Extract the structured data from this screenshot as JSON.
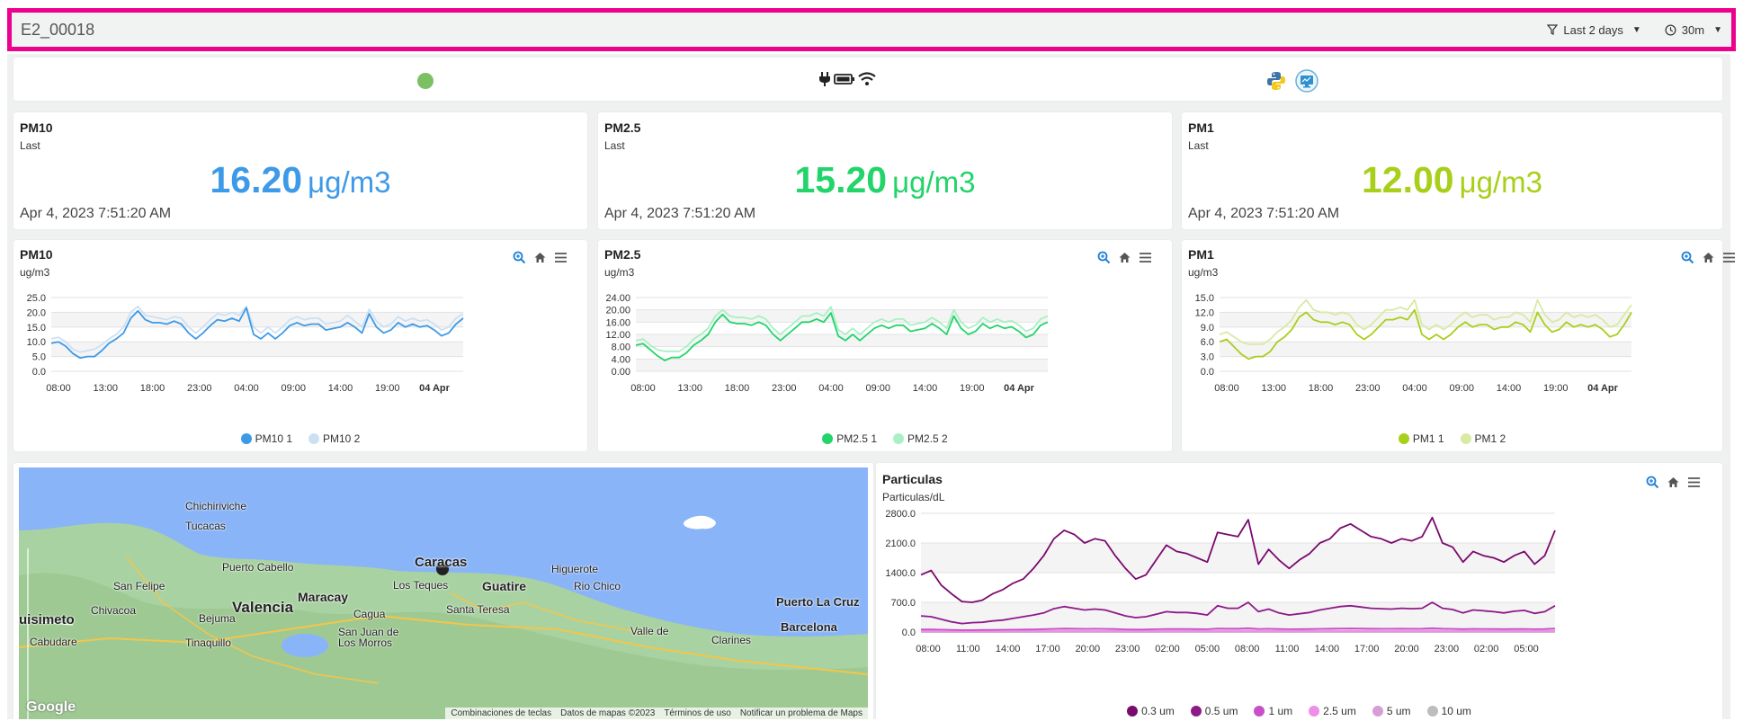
{
  "header": {
    "title": "E2_00018",
    "filter_label": "Last 2 days",
    "interval_label": "30m"
  },
  "status": {
    "dot_color": "#7cc063",
    "icons": [
      "plug-icon",
      "battery-icon",
      "wifi-icon",
      "python-icon",
      "monitor-icon"
    ]
  },
  "cards": [
    {
      "title": "PM10",
      "subtitle": "Last",
      "value": "16.20",
      "unit": "μg/m3",
      "time": "Apr 4, 2023 7:51:20 AM",
      "color": "#3d9ae8"
    },
    {
      "title": "PM2.5",
      "subtitle": "Last",
      "value": "15.20",
      "unit": "μg/m3",
      "time": "Apr 4, 2023 7:51:20 AM",
      "color": "#22d46a"
    },
    {
      "title": "PM1",
      "subtitle": "Last",
      "value": "12.00",
      "unit": "μg/m3",
      "time": "Apr 4, 2023 7:51:20 AM",
      "color": "#a8cf1a"
    }
  ],
  "charts": [
    {
      "title": "PM10",
      "subtitle": "ug/m3"
    },
    {
      "title": "PM2.5",
      "subtitle": "ug/m3"
    },
    {
      "title": "PM1",
      "subtitle": "ug/m3"
    }
  ],
  "particulas": {
    "title": "Particulas",
    "subtitle": "Particulas/dL"
  },
  "map": {
    "attribution": [
      "Combinaciones de teclas",
      "Datos de mapas ©2023",
      "Términos de uso",
      "Notificar un problema de Maps"
    ],
    "logo": "Google",
    "places": [
      "Chichiriviche",
      "Tucacas",
      "Puerto Cabello",
      "San Felipe",
      "Maracay",
      "Valencia",
      "Chivacoa",
      "Bejuma",
      "Cagua",
      "Tinaquillo",
      "San Juan de",
      "Los Morros",
      "Caracas",
      "Los Teques",
      "Guatire",
      "Higuerote",
      "Rio Chico",
      "Santa Teresa",
      "Puerto La Cruz",
      "Barcelona",
      "Clarines",
      "Valle de",
      "Cabudare",
      "uisimeto"
    ]
  },
  "chart_data": [
    {
      "type": "line",
      "title": "PM10",
      "ylabel": "ug/m3",
      "x": [
        "08:00",
        "13:00",
        "18:00",
        "23:00",
        "04:00",
        "09:00",
        "14:00",
        "19:00",
        "04 Apr"
      ],
      "yticks": [
        "25.0",
        "20.0",
        "15.0",
        "10.0",
        "5.0",
        "0.0"
      ],
      "ylim": [
        0,
        25
      ],
      "series": [
        {
          "name": "PM10 1",
          "color": "#3d9ae8",
          "values": [
            9.5,
            10,
            8.5,
            6,
            4.5,
            5,
            5,
            7,
            9.5,
            11,
            13,
            18,
            20.5,
            17.5,
            16.5,
            16.5,
            16,
            17,
            16,
            13,
            11,
            13,
            15.5,
            17.5,
            17,
            18,
            17,
            21.5,
            12.5,
            11,
            13,
            11,
            13,
            15.5,
            16.5,
            15.5,
            16,
            16,
            14,
            14.5,
            15,
            16.5,
            15,
            13,
            19.5,
            15,
            13,
            14,
            16.5,
            15,
            16,
            15,
            15.5,
            14,
            12,
            13,
            16,
            18
          ]
        },
        {
          "name": "PM10 2",
          "color": "#cde0f2",
          "values": [
            11,
            11.5,
            10,
            7.5,
            6.5,
            7,
            7.5,
            9,
            11,
            12.5,
            15,
            20,
            22,
            19,
            18.5,
            18,
            17.5,
            18.5,
            18,
            15,
            13,
            15,
            17.5,
            19.5,
            19,
            20,
            19,
            22,
            15,
            13,
            15,
            13,
            15,
            17.5,
            18.5,
            17.5,
            18,
            18,
            16,
            16.5,
            17,
            19,
            17,
            15,
            21,
            17,
            15,
            16,
            18.5,
            17,
            18,
            17,
            17.5,
            16,
            14,
            15,
            18,
            19.5
          ]
        }
      ]
    },
    {
      "type": "line",
      "title": "PM2.5",
      "ylabel": "ug/m3",
      "x": [
        "08:00",
        "13:00",
        "18:00",
        "23:00",
        "04:00",
        "09:00",
        "14:00",
        "19:00",
        "04 Apr"
      ],
      "yticks": [
        "24.00",
        "20.00",
        "16.00",
        "12.00",
        "8.00",
        "4.00",
        "0.00"
      ],
      "ylim": [
        0,
        24
      ],
      "series": [
        {
          "name": "PM2.5 1",
          "color": "#22d46a",
          "values": [
            8.5,
            9,
            7,
            5,
            3.5,
            4.5,
            4.5,
            6,
            8.5,
            10,
            12,
            16,
            18.5,
            16,
            15.5,
            15.5,
            15,
            16,
            15,
            12,
            10,
            12,
            14,
            16,
            16,
            17,
            16,
            19,
            11.5,
            10,
            12,
            10,
            12,
            14,
            15,
            14,
            15,
            15,
            13,
            13.5,
            14,
            15.5,
            14,
            12,
            18,
            14,
            12,
            13,
            15.5,
            14,
            15,
            14,
            14.5,
            13,
            11,
            12,
            15,
            16
          ]
        },
        {
          "name": "PM2.5 2",
          "color": "#a9f0c3",
          "values": [
            10,
            10.5,
            8.5,
            7,
            6.5,
            6.5,
            6.5,
            8,
            10.5,
            12,
            14,
            18,
            20,
            18,
            17.5,
            17.5,
            17,
            18,
            17,
            14,
            12,
            14,
            16,
            18,
            18,
            19,
            18,
            21,
            13.5,
            12,
            14,
            12,
            14,
            16,
            17,
            16,
            17,
            17,
            15,
            15.5,
            16,
            17.5,
            16,
            14,
            20,
            16,
            14,
            15,
            17.5,
            16,
            17,
            16,
            16.5,
            15,
            13,
            14,
            17,
            18
          ]
        }
      ]
    },
    {
      "type": "line",
      "title": "PM1",
      "ylabel": "ug/m3",
      "x": [
        "08:00",
        "13:00",
        "18:00",
        "23:00",
        "04:00",
        "09:00",
        "14:00",
        "19:00",
        "04 Apr"
      ],
      "yticks": [
        "15.0",
        "12.0",
        "9.0",
        "6.0",
        "3.0",
        "0.0"
      ],
      "ylim": [
        0,
        15
      ],
      "series": [
        {
          "name": "PM1 1",
          "color": "#a8cf1a",
          "values": [
            6,
            6.5,
            5,
            3.5,
            2.5,
            3,
            3,
            4,
            6,
            7,
            8.5,
            11,
            12,
            10.5,
            10,
            10,
            9.5,
            10,
            9.5,
            7.5,
            6.5,
            7.5,
            9,
            10.5,
            10.5,
            11,
            10.5,
            12.5,
            7.5,
            6.5,
            7.5,
            6.5,
            7.5,
            9,
            10,
            9,
            9.5,
            9.5,
            8.5,
            9,
            9,
            10,
            9.5,
            8,
            12,
            9.5,
            8,
            8.5,
            10,
            9,
            9.5,
            9,
            9.5,
            8.5,
            7,
            7.5,
            9.5,
            12
          ]
        },
        {
          "name": "PM1 2",
          "color": "#d8eaa3",
          "values": [
            7.5,
            8,
            7,
            6,
            5.5,
            5.5,
            5.5,
            6.5,
            8,
            9,
            10.5,
            13,
            14.5,
            12.5,
            12,
            12,
            11.5,
            12,
            11.5,
            9.5,
            8.5,
            9.5,
            11,
            12.5,
            12.5,
            13,
            12.5,
            14.5,
            9.5,
            8.5,
            9.5,
            8.5,
            9.5,
            11,
            12,
            11,
            11.5,
            11.5,
            10.5,
            11,
            11,
            12,
            11.5,
            10,
            14.5,
            11.5,
            10,
            10.5,
            12,
            11,
            11.5,
            11,
            11.5,
            10.5,
            9,
            9.5,
            11.5,
            13.5
          ]
        }
      ]
    },
    {
      "type": "line",
      "title": "Particulas",
      "ylabel": "Particulas/dL",
      "x": [
        "08:00",
        "11:00",
        "14:00",
        "17:00",
        "20:00",
        "23:00",
        "02:00",
        "05:00",
        "08:00",
        "11:00",
        "14:00",
        "17:00",
        "20:00",
        "23:00",
        "02:00",
        "05:00"
      ],
      "yticks": [
        "2800.0",
        "2100.0",
        "1400.0",
        "700.0",
        "0.0"
      ],
      "ylim": [
        0,
        2800
      ],
      "series": [
        {
          "name": "0.3 um",
          "color": "#7a0a6e",
          "values": [
            1350,
            1450,
            1100,
            900,
            720,
            700,
            750,
            900,
            1000,
            1150,
            1250,
            1500,
            1800,
            2200,
            2400,
            2300,
            2100,
            2200,
            2150,
            1800,
            1500,
            1250,
            1350,
            1700,
            2050,
            1900,
            1850,
            1750,
            1650,
            2350,
            2300,
            2250,
            2650,
            1600,
            1950,
            1700,
            1500,
            1700,
            1850,
            2100,
            2200,
            2450,
            2550,
            2400,
            2250,
            2200,
            2100,
            2200,
            2150,
            2250,
            2700,
            2100,
            2000,
            1650,
            1900,
            1800,
            1750,
            1650,
            1800,
            1900,
            1600,
            1800,
            2400
          ]
        },
        {
          "name": "0.5 um",
          "color": "#8e1a8a",
          "values": [
            380,
            360,
            300,
            240,
            200,
            220,
            230,
            260,
            280,
            320,
            360,
            400,
            450,
            550,
            600,
            560,
            520,
            540,
            520,
            450,
            380,
            340,
            360,
            420,
            480,
            460,
            460,
            440,
            400,
            620,
            560,
            560,
            700,
            480,
            540,
            450,
            400,
            430,
            460,
            520,
            560,
            600,
            620,
            590,
            560,
            550,
            540,
            560,
            550,
            560,
            700,
            560,
            530,
            450,
            520,
            500,
            480,
            450,
            490,
            510,
            440,
            480,
            620
          ]
        },
        {
          "name": "1 um",
          "color": "#c84fc7",
          "values": [
            60,
            60,
            55,
            50,
            45,
            45,
            48,
            50,
            52,
            55,
            58,
            62,
            68,
            75,
            80,
            78,
            75,
            76,
            75,
            70,
            62,
            58,
            60,
            66,
            72,
            70,
            70,
            68,
            65,
            82,
            78,
            78,
            90,
            72,
            76,
            70,
            65,
            68,
            70,
            74,
            78,
            82,
            84,
            80,
            78,
            77,
            76,
            78,
            77,
            78,
            90,
            78,
            75,
            68,
            74,
            72,
            70,
            68,
            71,
            73,
            66,
            70,
            82
          ]
        },
        {
          "name": "2.5 um",
          "color": "#ef8ee6",
          "values": [
            25,
            25,
            22,
            20,
            18,
            18,
            19,
            20,
            21,
            22,
            23,
            25,
            27,
            30,
            32,
            31,
            30,
            30,
            30,
            28,
            25,
            23,
            24,
            26,
            29,
            28,
            28,
            27,
            26,
            33,
            31,
            31,
            36,
            29,
            30,
            28,
            26,
            27,
            28,
            30,
            31,
            33,
            34,
            32,
            31,
            31,
            30,
            31,
            31,
            31,
            36,
            31,
            30,
            27,
            30,
            29,
            28,
            27,
            28,
            29,
            26,
            28,
            33
          ]
        },
        {
          "name": "5 um",
          "color": "#d79ed5",
          "values": [
            5,
            5,
            5,
            4,
            4,
            4,
            4,
            4,
            4,
            5,
            5,
            5,
            6,
            6,
            7,
            6,
            6,
            6,
            6,
            6,
            5,
            5,
            5,
            5,
            6,
            6,
            6,
            6,
            5,
            7,
            6,
            6,
            7,
            6,
            6,
            6,
            5,
            6,
            6,
            6,
            6,
            7,
            7,
            6,
            6,
            6,
            6,
            6,
            6,
            6,
            7,
            6,
            6,
            6,
            6,
            6,
            6,
            6,
            6,
            6,
            5,
            6,
            7
          ]
        },
        {
          "name": "10 um",
          "color": "#bdbdbd",
          "values": [
            1,
            1,
            1,
            1,
            1,
            1,
            1,
            1,
            1,
            1,
            1,
            1,
            1,
            1,
            1,
            1,
            1,
            1,
            1,
            1,
            1,
            1,
            1,
            1,
            1,
            1,
            1,
            1,
            1,
            1,
            1,
            1,
            1,
            1,
            1,
            1,
            1,
            1,
            1,
            1,
            1,
            1,
            1,
            1,
            1,
            1,
            1,
            1,
            1,
            1,
            1,
            1,
            1,
            1,
            1,
            1,
            1,
            1,
            1,
            1,
            1,
            1,
            1
          ]
        }
      ]
    }
  ]
}
